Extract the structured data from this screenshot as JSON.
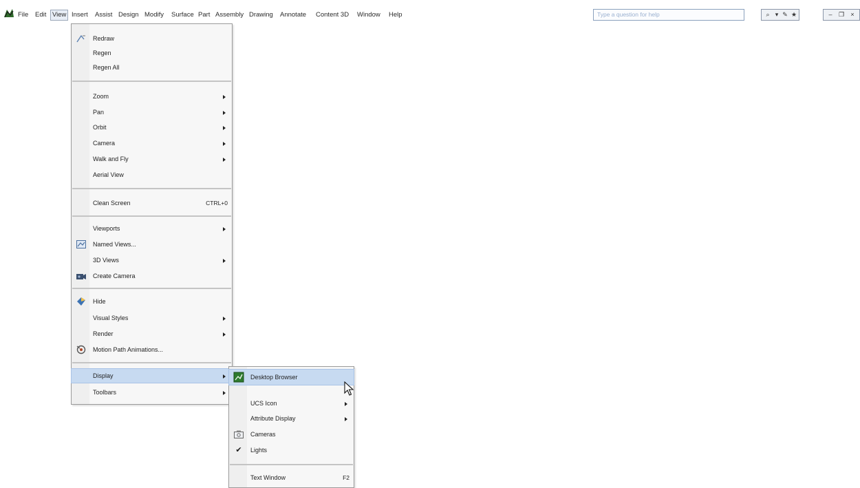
{
  "menubar": {
    "items": [
      {
        "label": "File"
      },
      {
        "label": "Edit"
      },
      {
        "label": "View"
      },
      {
        "label": "Insert"
      },
      {
        "label": "Assist"
      },
      {
        "label": "Design"
      },
      {
        "label": "Modify"
      },
      {
        "label": "Surface"
      },
      {
        "label": "Part"
      },
      {
        "label": "Assembly"
      },
      {
        "label": "Drawing"
      },
      {
        "label": "Annotate"
      },
      {
        "label": "Content 3D"
      },
      {
        "label": "Window"
      },
      {
        "label": "Help"
      }
    ],
    "help_search_placeholder": "Type a question for help"
  },
  "view_menu": {
    "items": [
      {
        "label": "Redraw"
      },
      {
        "label": "Regen"
      },
      {
        "label": "Regen All"
      },
      {
        "label": "Zoom"
      },
      {
        "label": "Pan"
      },
      {
        "label": "Orbit"
      },
      {
        "label": "Camera"
      },
      {
        "label": "Walk and Fly"
      },
      {
        "label": "Aerial View"
      },
      {
        "label": "Clean Screen",
        "shortcut": "CTRL+0"
      },
      {
        "label": "Viewports"
      },
      {
        "label": "Named Views..."
      },
      {
        "label": "3D Views"
      },
      {
        "label": "Create Camera"
      },
      {
        "label": "Hide"
      },
      {
        "label": "Visual Styles"
      },
      {
        "label": "Render"
      },
      {
        "label": "Motion Path Animations..."
      },
      {
        "label": "Display"
      },
      {
        "label": "Toolbars"
      }
    ]
  },
  "display_submenu": {
    "items": [
      {
        "label": "Desktop Browser"
      },
      {
        "label": "UCS Icon"
      },
      {
        "label": "Attribute Display"
      },
      {
        "label": "Cameras"
      },
      {
        "label": "Lights"
      },
      {
        "label": "Text Window",
        "shortcut": "F2"
      }
    ]
  },
  "colors": {
    "highlight": "#c7daf1",
    "menu_bg": "#f7f7f7",
    "menu_border": "#9a9a9a"
  }
}
